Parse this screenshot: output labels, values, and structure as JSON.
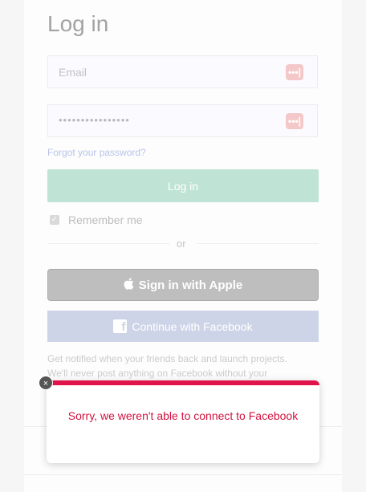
{
  "page": {
    "title": "Log in"
  },
  "form": {
    "email_placeholder": "Email",
    "password_mask": "••••••••••••••••",
    "password_manager_icon": "password-manager-icon",
    "password_manager_glyph": "•••|",
    "forgot_password": "Forgot your password?",
    "login_button": "Log in",
    "remember_me": "Remember me",
    "remember_checked": true,
    "checkbox_glyph": "✓",
    "or_separator": "or"
  },
  "social": {
    "apple_glyph": "",
    "apple_label": "Sign in with Apple",
    "facebook_glyph": "f",
    "facebook_label": "Continue with Facebook"
  },
  "notice": {
    "line1": "Get notified when your friends back and launch projects.",
    "line2": "We'll never post anything on Facebook without your"
  },
  "toast": {
    "message": "Sorry, we weren't able to connect to Facebook",
    "close_glyph": "×",
    "accent_color": "#e0134a"
  }
}
